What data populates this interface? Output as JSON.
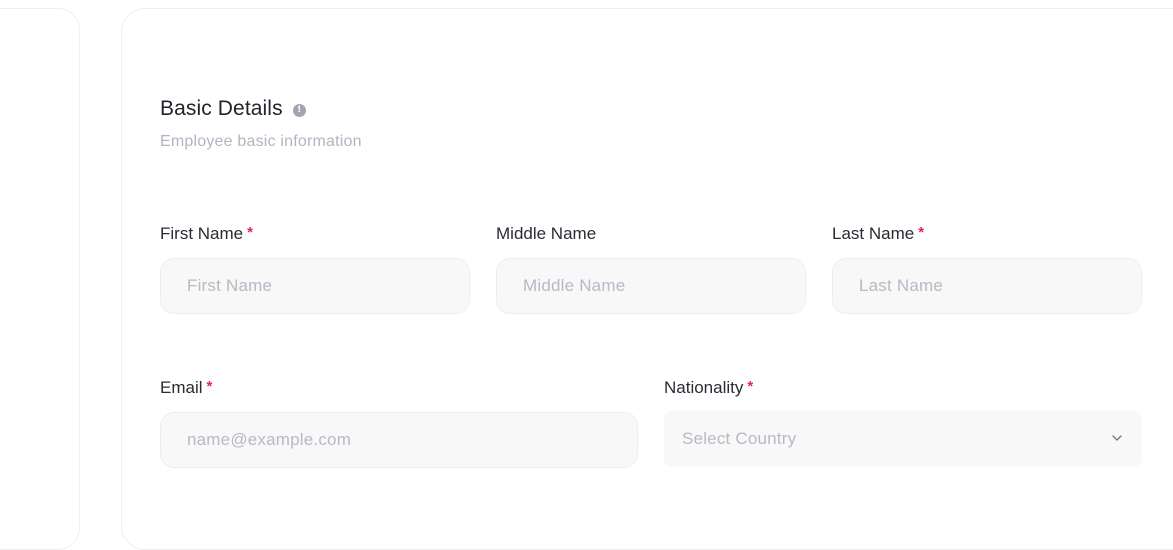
{
  "section": {
    "title": "Basic Details",
    "info_icon": "info-icon",
    "subtitle": "Employee basic information"
  },
  "fields": {
    "first_name": {
      "label": "First Name",
      "required": "*",
      "placeholder": "First Name"
    },
    "middle_name": {
      "label": "Middle Name",
      "placeholder": "Middle Name"
    },
    "last_name": {
      "label": "Last Name",
      "required": "*",
      "placeholder": "Last Name"
    },
    "email": {
      "label": "Email",
      "required": "*",
      "placeholder": "name@example.com"
    },
    "nationality": {
      "label": "Nationality",
      "required": "*",
      "placeholder": "Select Country",
      "icon": "chevron-down-icon"
    }
  },
  "colors": {
    "required": "#e8234d",
    "title": "#22232b",
    "placeholder": "#b8b9c4",
    "input_bg": "#f8f8f9"
  }
}
